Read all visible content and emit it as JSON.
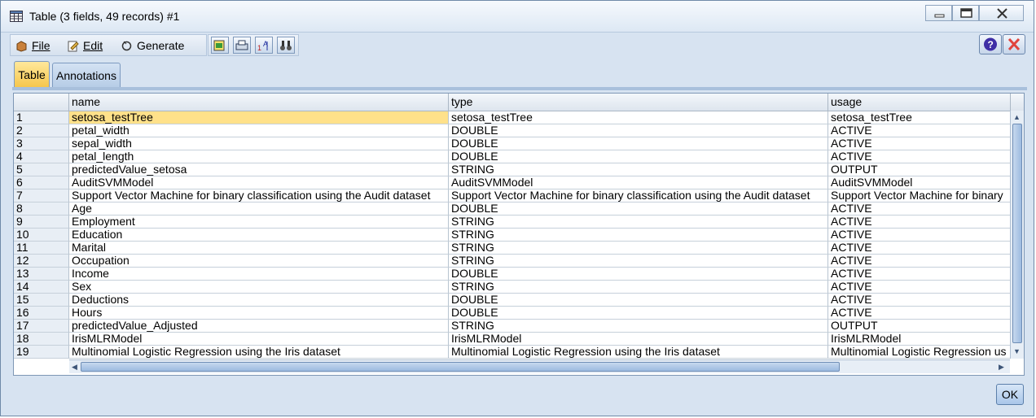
{
  "window": {
    "title": "Table (3 fields, 49 records) #1"
  },
  "menu": {
    "file": "File",
    "edit": "Edit",
    "generate": "Generate"
  },
  "toolbar": {
    "icons": [
      "export-icon",
      "print-icon",
      "sort-icon",
      "find-icon"
    ]
  },
  "tabs": [
    {
      "label": "Table",
      "active": true
    },
    {
      "label": "Annotations",
      "active": false
    }
  ],
  "table": {
    "columns": [
      "name",
      "type",
      "usage"
    ],
    "rows": [
      {
        "n": "1",
        "name": "setosa_testTree",
        "type": "setosa_testTree",
        "usage": "setosa_testTree"
      },
      {
        "n": "2",
        "name": "petal_width",
        "type": "DOUBLE",
        "usage": "ACTIVE"
      },
      {
        "n": "3",
        "name": "sepal_width",
        "type": "DOUBLE",
        "usage": "ACTIVE"
      },
      {
        "n": "4",
        "name": "petal_length",
        "type": "DOUBLE",
        "usage": "ACTIVE"
      },
      {
        "n": "5",
        "name": "predictedValue_setosa",
        "type": "STRING",
        "usage": "OUTPUT"
      },
      {
        "n": "6",
        "name": "AuditSVMModel",
        "type": "AuditSVMModel",
        "usage": "AuditSVMModel"
      },
      {
        "n": "7",
        "name": "Support Vector Machine for binary classification using the Audit dataset",
        "type": "Support Vector Machine for binary classification using the Audit dataset",
        "usage": "Support Vector Machine for binary"
      },
      {
        "n": "8",
        "name": "Age",
        "type": "DOUBLE",
        "usage": "ACTIVE"
      },
      {
        "n": "9",
        "name": "Employment",
        "type": "STRING",
        "usage": "ACTIVE"
      },
      {
        "n": "10",
        "name": "Education",
        "type": "STRING",
        "usage": "ACTIVE"
      },
      {
        "n": "11",
        "name": "Marital",
        "type": "STRING",
        "usage": "ACTIVE"
      },
      {
        "n": "12",
        "name": "Occupation",
        "type": "STRING",
        "usage": "ACTIVE"
      },
      {
        "n": "13",
        "name": "Income",
        "type": "DOUBLE",
        "usage": "ACTIVE"
      },
      {
        "n": "14",
        "name": "Sex",
        "type": "STRING",
        "usage": "ACTIVE"
      },
      {
        "n": "15",
        "name": "Deductions",
        "type": "DOUBLE",
        "usage": "ACTIVE"
      },
      {
        "n": "16",
        "name": "Hours",
        "type": "DOUBLE",
        "usage": "ACTIVE"
      },
      {
        "n": "17",
        "name": "predictedValue_Adjusted",
        "type": "STRING",
        "usage": "OUTPUT"
      },
      {
        "n": "18",
        "name": "IrisMLRModel",
        "type": "IrisMLRModel",
        "usage": "IrisMLRModel"
      },
      {
        "n": "19",
        "name": "Multinomial Logistic Regression using the Iris dataset",
        "type": "Multinomial Logistic Regression using the Iris dataset",
        "usage": "Multinomial Logistic Regression us"
      }
    ]
  },
  "footer": {
    "ok": "OK"
  },
  "colors": {
    "selected_row": "#ffe18a",
    "close_button": "#e0443e",
    "help_button": "#3f2ea6"
  }
}
